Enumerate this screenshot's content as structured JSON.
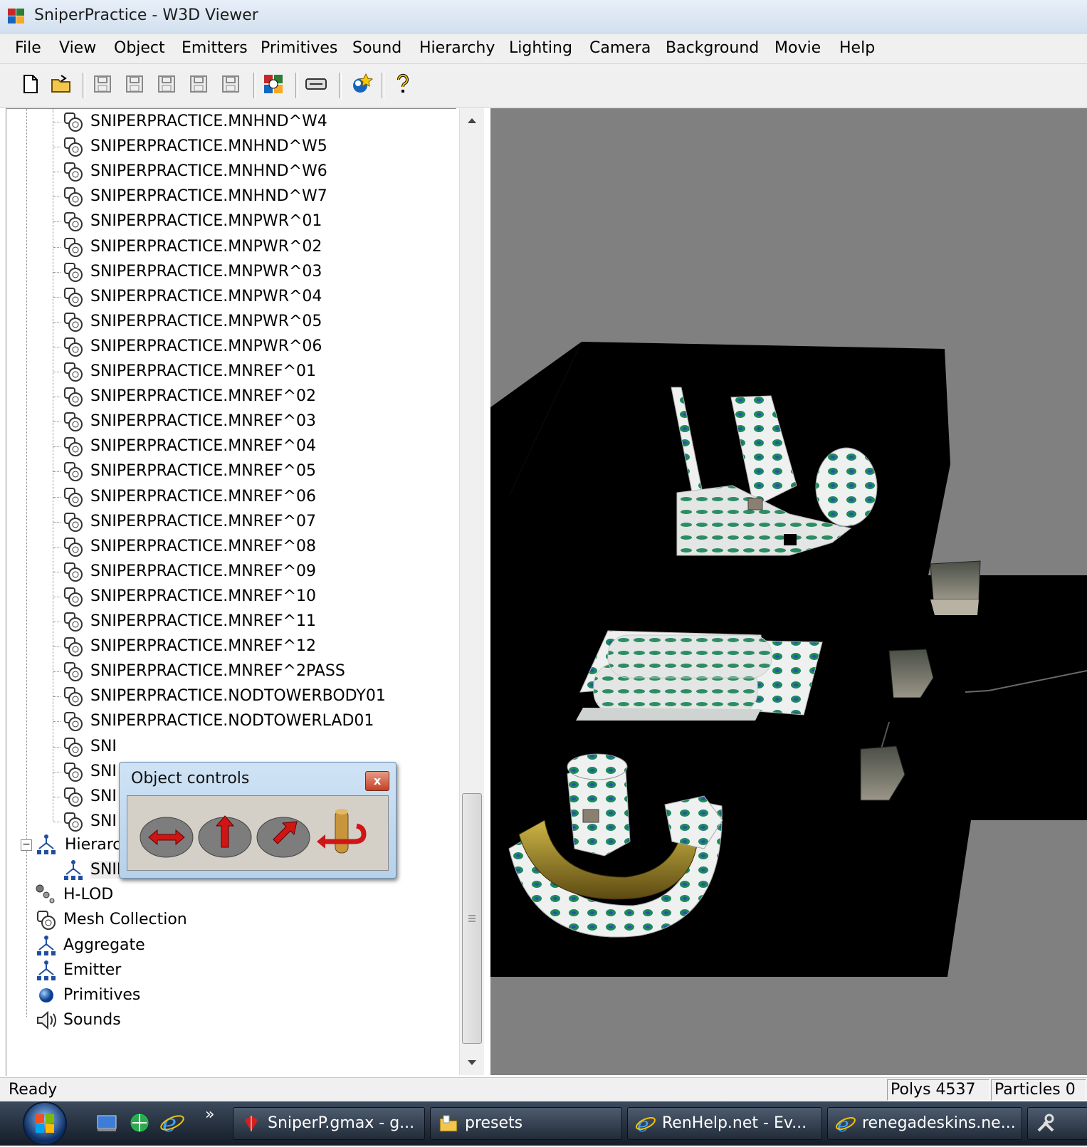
{
  "window": {
    "title": "SniperPractice - W3D Viewer"
  },
  "menu": [
    "File",
    "View",
    "Object",
    "Emitters",
    "Primitives",
    "Sound",
    "Hierarchy",
    "Lighting",
    "Camera",
    "Background",
    "Movie",
    "Help"
  ],
  "toolbar": {
    "icons": [
      "new-file-icon",
      "open-folder-icon",
      "save-icon",
      "save-icon",
      "save-icon",
      "save-icon",
      "save-icon",
      "color-settings-icon",
      "keyboard-icon",
      "emitter-icon",
      "help-icon"
    ]
  },
  "tree": {
    "meshes": [
      "SNIPERPRACTICE.MNHND^W4",
      "SNIPERPRACTICE.MNHND^W5",
      "SNIPERPRACTICE.MNHND^W6",
      "SNIPERPRACTICE.MNHND^W7",
      "SNIPERPRACTICE.MNPWR^01",
      "SNIPERPRACTICE.MNPWR^02",
      "SNIPERPRACTICE.MNPWR^03",
      "SNIPERPRACTICE.MNPWR^04",
      "SNIPERPRACTICE.MNPWR^05",
      "SNIPERPRACTICE.MNPWR^06",
      "SNIPERPRACTICE.MNREF^01",
      "SNIPERPRACTICE.MNREF^02",
      "SNIPERPRACTICE.MNREF^03",
      "SNIPERPRACTICE.MNREF^04",
      "SNIPERPRACTICE.MNREF^05",
      "SNIPERPRACTICE.MNREF^06",
      "SNIPERPRACTICE.MNREF^07",
      "SNIPERPRACTICE.MNREF^08",
      "SNIPERPRACTICE.MNREF^09",
      "SNIPERPRACTICE.MNREF^10",
      "SNIPERPRACTICE.MNREF^11",
      "SNIPERPRACTICE.MNREF^12",
      "SNIPERPRACTICE.MNREF^2PASS",
      "SNIPERPRACTICE.NODTOWERBODY01",
      "SNIPERPRACTICE.NODTOWERLAD01",
      "SNI",
      "SNI",
      "SNI",
      "SNI"
    ],
    "hierarchy_label": "Hierarc",
    "hierarchy_child": "SNIPERPRACTICE",
    "categories": [
      "H-LOD",
      "Mesh Collection",
      "Aggregate",
      "Emitter",
      "Primitives",
      "Sounds"
    ]
  },
  "object_controls": {
    "title": "Object controls",
    "close": "x"
  },
  "status": {
    "text": "Ready",
    "polys": "Polys 4537",
    "particles": "Particles 0"
  },
  "taskbar": {
    "overflow": "»",
    "buttons": [
      "SniperP.gmax - g...",
      "presets",
      "RenHelp.net - Ev...",
      "renegadeskins.ne..."
    ]
  },
  "colors": {
    "viewport_bg": "#808080",
    "floor": "#000000",
    "accent": "#2f6fb0"
  }
}
